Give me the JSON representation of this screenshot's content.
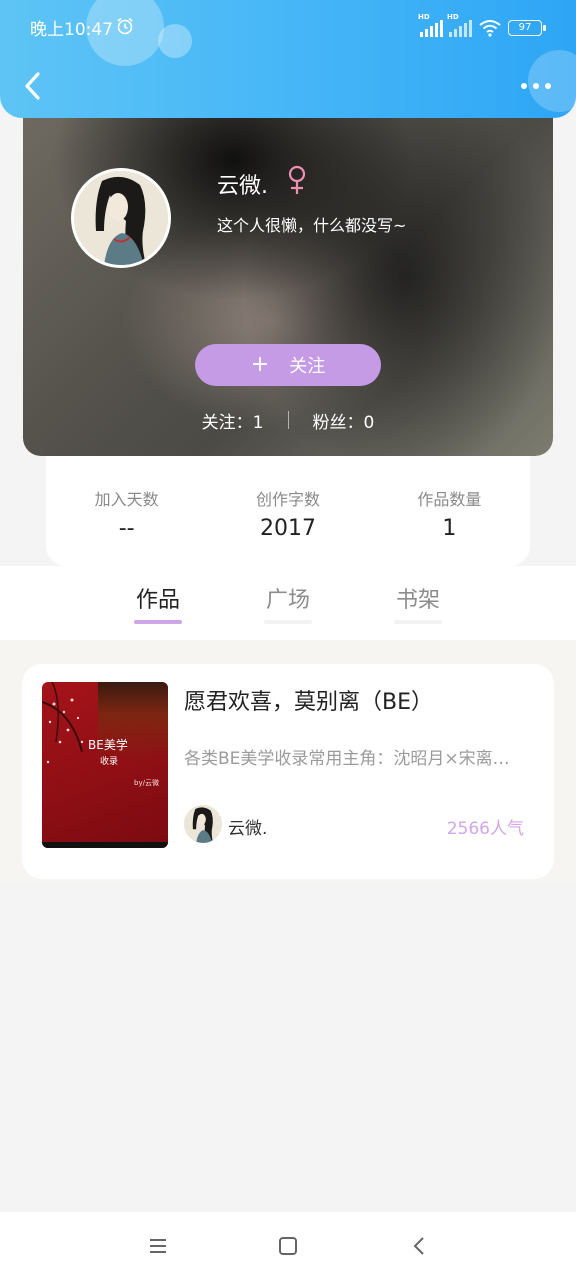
{
  "status_bar": {
    "time": "晚上10:47",
    "battery": "97",
    "signal_label": "HD"
  },
  "header": {
    "back_icon": "chevron-left-icon",
    "more_icon": "more-dots-icon"
  },
  "profile": {
    "nickname": "云微.",
    "gender_symbol": "♀",
    "bio": "这个人很懒，什么都没写~",
    "follow_plus": "+",
    "follow_label": "关注",
    "following": "关注：1",
    "followers": "粉丝：0"
  },
  "stats": [
    {
      "label": "加入天数",
      "value": "--"
    },
    {
      "label": "创作字数",
      "value": "2017"
    },
    {
      "label": "作品数量",
      "value": "1"
    }
  ],
  "tabs": [
    {
      "label": "作品",
      "active": true
    },
    {
      "label": "广场",
      "active": false
    },
    {
      "label": "书架",
      "active": false
    }
  ],
  "work": {
    "title": "愿君欢喜，莫别离（BE）",
    "description": "各类BE美学收录常用主角：沈昭月×宋离…",
    "author": "云微.",
    "popularity": "2566人气",
    "cover_title": "BE美学",
    "cover_subtitle": "收录",
    "cover_by": "by/云微"
  },
  "colors": {
    "header_blue": "#49b8f7",
    "accent_purple": "#c59be6",
    "popularity": "#d3a6e8",
    "gender_pink": "#ef8fb3"
  },
  "nav": {
    "menu_icon": "menu-icon",
    "home_icon": "home-square-icon",
    "back_icon": "nav-back-icon"
  }
}
